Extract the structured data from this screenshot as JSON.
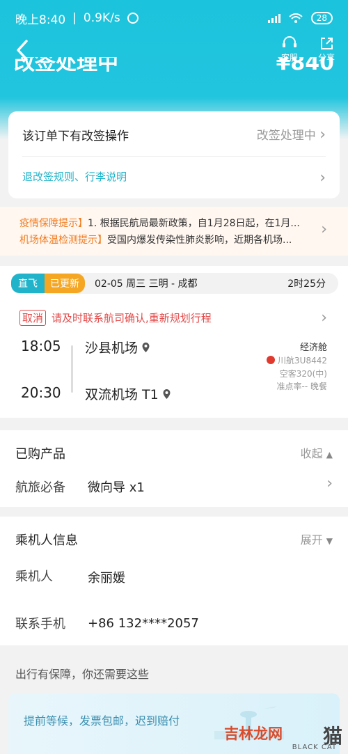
{
  "status_bar": {
    "time": "晚上8:40",
    "speed": "0.9K/s",
    "battery": "28"
  },
  "nav": {
    "service_label": "客服",
    "share_label": "分享"
  },
  "header": {
    "title_partial": "改签处理中",
    "price_partial": "¥840"
  },
  "change_card": {
    "notice": "该订单下有改签操作",
    "status": "改签处理中",
    "rules_link": "退改签规则、行李说明"
  },
  "epidemic_notice": {
    "tag1": "疫情保障提示】",
    "text1": "1. 根据民航局最新政策，自1月28日起，在1月...",
    "tag2": "机场体温检测提示】",
    "text2": "受国内爆发传染性肺炎影响，近期各机场..."
  },
  "flight": {
    "chip_direct": "直飞",
    "chip_updated": "已更新",
    "date_route": "02-05  周三   三明 - 成都",
    "duration": "2时25分",
    "cancel_tag": "取消",
    "cancel_text": "请及时联系航司确认,重新规划行程",
    "depart_time": "18:05",
    "depart_airport": "沙县机场",
    "arrive_time": "20:30",
    "arrive_airport": "双流机场 T1",
    "cabin": "经济舱",
    "airline_flight": "川航3U8442",
    "aircraft": "空客320(中)",
    "ontime_meal": "准点率-- 晚餐"
  },
  "products": {
    "title": "已购产品",
    "toggle": "收起",
    "item_label": "航旅必备",
    "item_value": "微向导 x1"
  },
  "passenger": {
    "title": "乘机人信息",
    "toggle": "展开",
    "name_label": "乘机人",
    "name_value": "余丽媛",
    "phone_label": "联系手机",
    "phone_value": "+86 132****2057"
  },
  "promo": {
    "heading": "出行有保障，你还需要这些",
    "card_text": "提前等候，发票包邮，迟到赔付"
  },
  "watermark": {
    "cn": "吉林龙网",
    "en": "BLACK CAT"
  },
  "colors": {
    "header": "#1cc3dc",
    "accent": "#21b3c9",
    "warning": "#f07b1f",
    "cancel": "#e24a4a"
  }
}
